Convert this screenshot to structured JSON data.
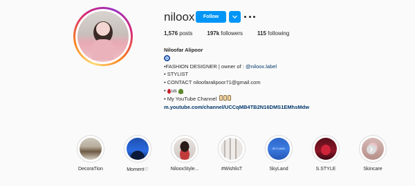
{
  "profile": {
    "username": "niloox",
    "follow_label": "Follow",
    "stats": {
      "posts": "1,576",
      "posts_label": "posts",
      "followers": "197k",
      "followers_label": "followers",
      "following": "115",
      "following_label": "following"
    }
  },
  "bio": {
    "full_name": "Niloofar Alipoor",
    "line1_prefix": "•FASHION DESIGNER | owner of : ",
    "line1_link": "@niloox.label",
    "line2": "• STYLIST",
    "line3": "• CONTACT niloofaralipoor71@gmail.com",
    "line4_text": "us",
    "line5": "• My YouTube Channel",
    "url": "m.youtube.com/channel/UCCqMB4TB2N16DMS1EMhsMdw"
  },
  "highlights": [
    {
      "label": "DecoraTion"
    },
    {
      "label": "Moment♡"
    },
    {
      "label": "NilooxStyle..."
    },
    {
      "label": "#WishlisT"
    },
    {
      "label": "SkyLand"
    },
    {
      "label": "S.STYLE"
    },
    {
      "label": "Skincare"
    }
  ],
  "colors": {
    "primary_button": "#0095f6",
    "link": "#00376b",
    "background": "#fafafa"
  },
  "icons": {
    "dropdown": "chevron-down-icon",
    "more": "more-options-icon",
    "next": "chevron-right-icon"
  }
}
